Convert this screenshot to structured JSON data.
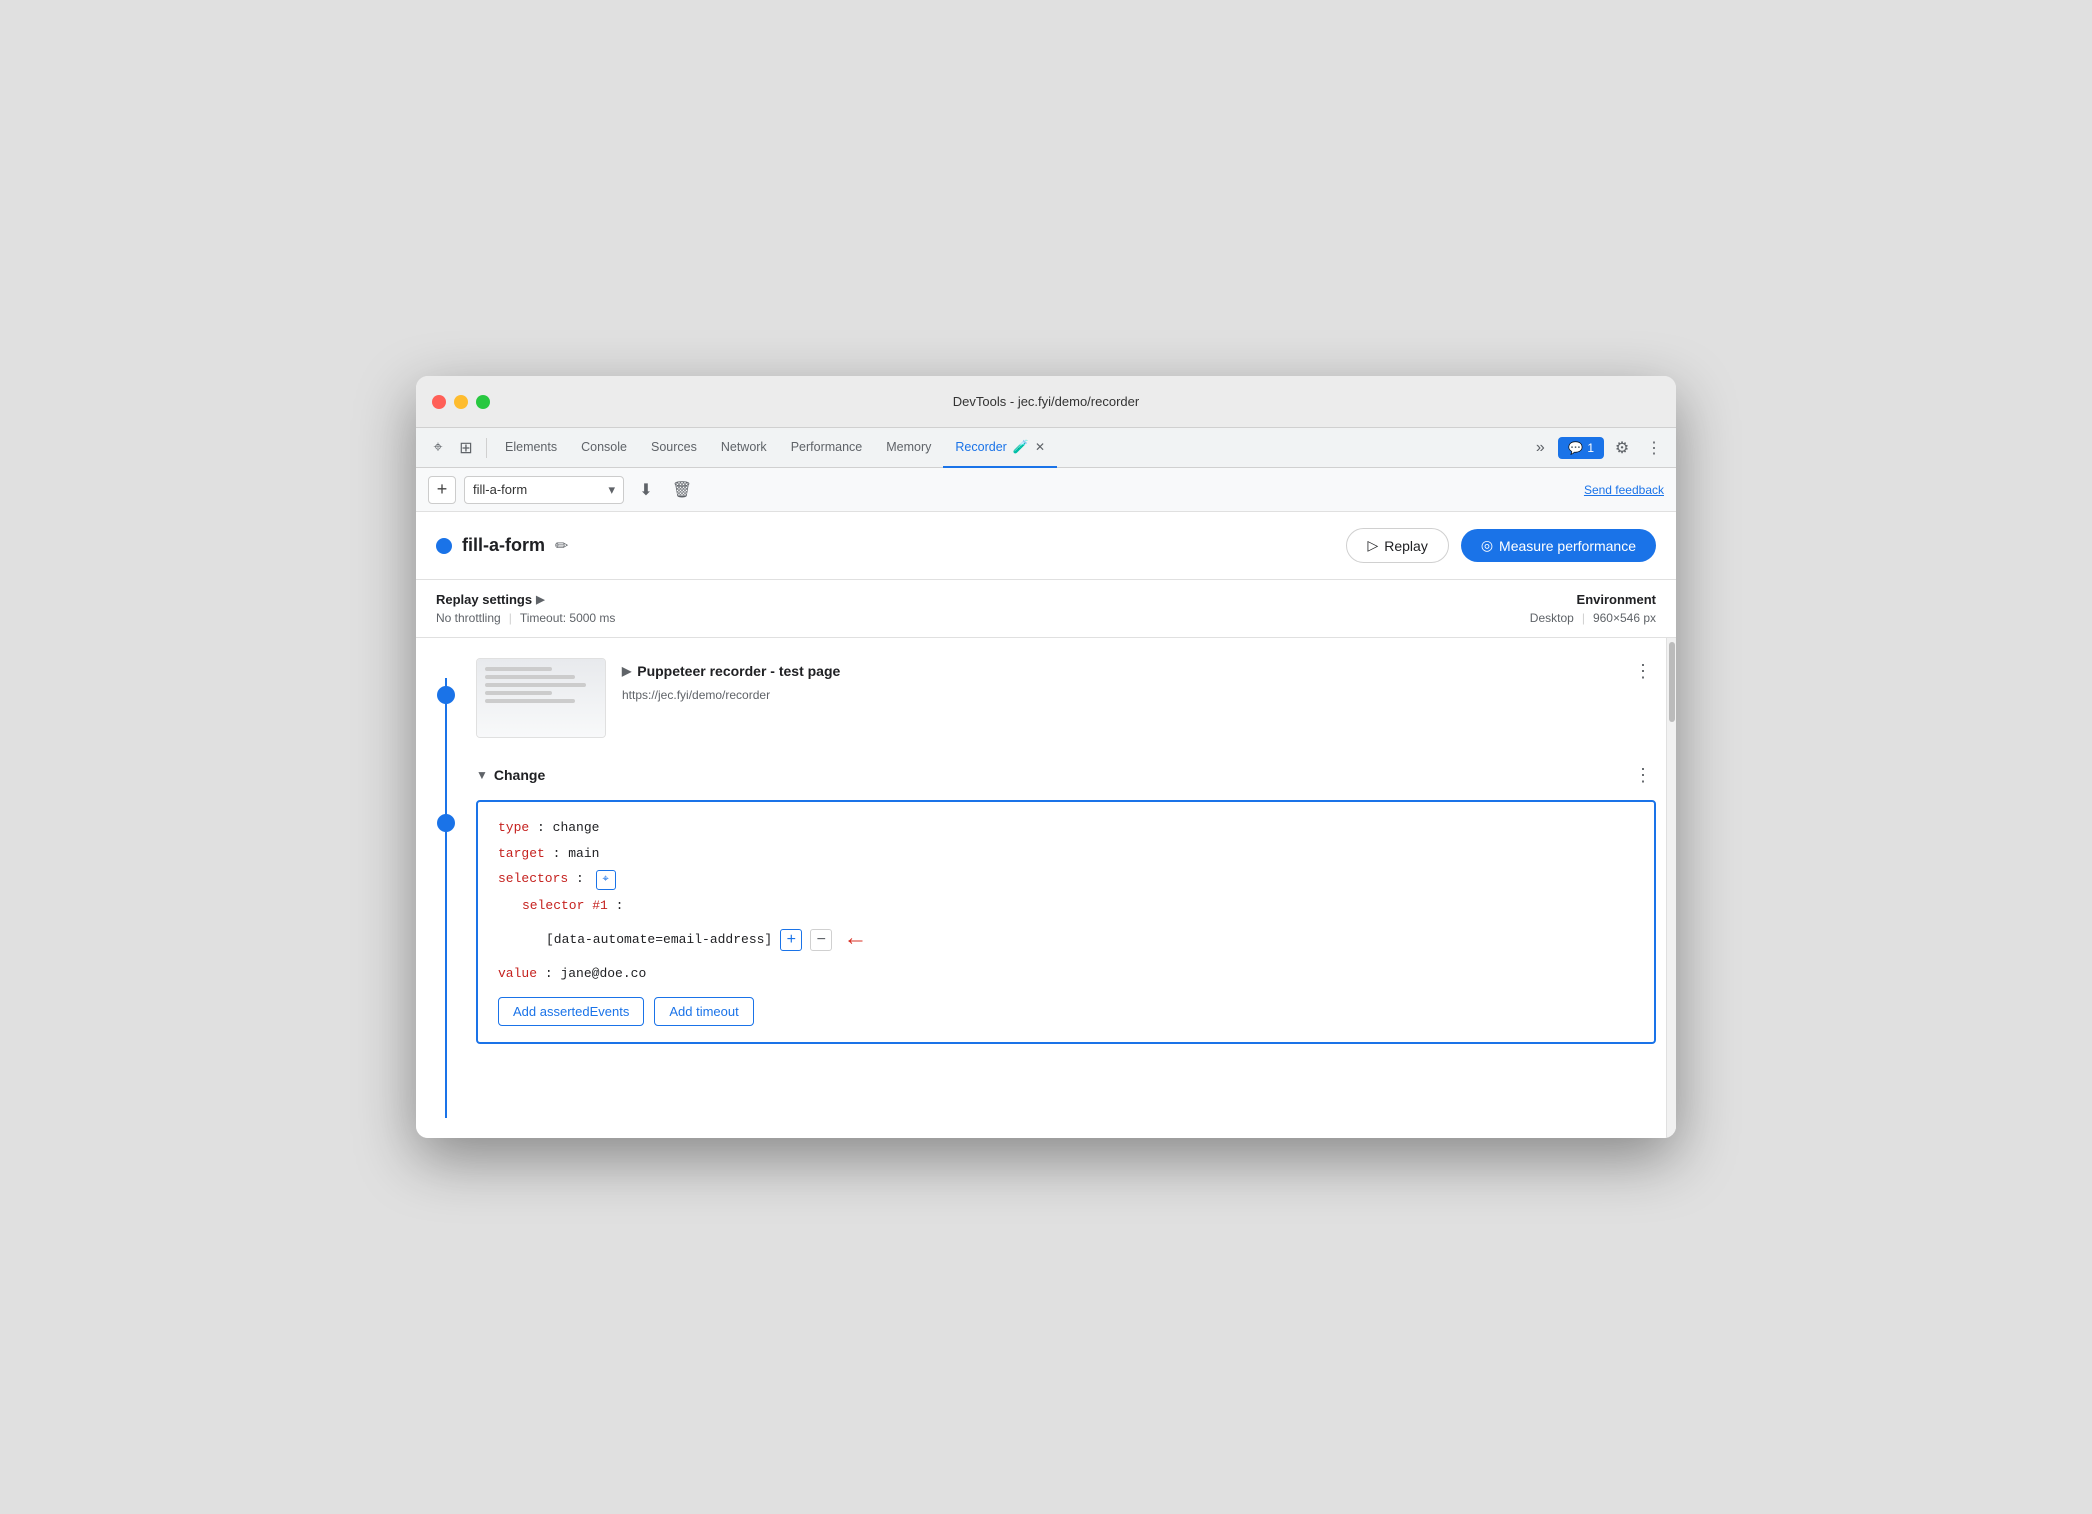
{
  "window": {
    "title": "DevTools - jec.fyi/demo/recorder"
  },
  "titlebar": {
    "title": "DevTools - jec.fyi/demo/recorder"
  },
  "devtools_tabs": {
    "items": [
      {
        "id": "elements",
        "label": "Elements"
      },
      {
        "id": "console",
        "label": "Console"
      },
      {
        "id": "sources",
        "label": "Sources"
      },
      {
        "id": "network",
        "label": "Network"
      },
      {
        "id": "performance",
        "label": "Performance"
      },
      {
        "id": "memory",
        "label": "Memory"
      },
      {
        "id": "recorder",
        "label": "Recorder",
        "active": true
      }
    ],
    "more_icon": "»",
    "chat_count": "1",
    "settings_icon": "⚙",
    "more_options_icon": "⋮"
  },
  "recorder_toolbar": {
    "add_icon": "+",
    "recording_name": "fill-a-form",
    "dropdown_icon": "▾",
    "export_icon": "↓",
    "delete_icon": "🗑",
    "send_feedback": "Send feedback"
  },
  "recording_header": {
    "dot_color": "#1a73e8",
    "title": "fill-a-form",
    "edit_icon": "✏",
    "replay_label": "Replay",
    "measure_label": "Measure performance"
  },
  "settings": {
    "section_title": "Replay settings",
    "expand_icon": "▶",
    "no_throttling": "No throttling",
    "timeout": "Timeout: 5000 ms",
    "environment_title": "Environment",
    "desktop": "Desktop",
    "resolution": "960×546 px"
  },
  "steps": {
    "step1": {
      "title": "Puppeteer recorder - test page",
      "url": "https://jec.fyi/demo/recorder",
      "expanded": false
    },
    "step2": {
      "title": "Change",
      "expanded": true,
      "code": {
        "type_key": "type",
        "type_val": "change",
        "target_key": "target",
        "target_val": "main",
        "selectors_key": "selectors",
        "selector_number_key": "selector #1",
        "selector_value": "[data-automate=email-address]",
        "value_key": "value",
        "value_val": "jane@doe.co"
      },
      "add_asserted_label": "Add assertedEvents",
      "add_timeout_label": "Add timeout"
    }
  },
  "icons": {
    "cursor": "⌖",
    "expand_all": "⊞",
    "replay_play": "▷",
    "measure_perf": "◎",
    "pencil": "✏",
    "selector_cursor": "⌖",
    "red_arrow": "←"
  }
}
